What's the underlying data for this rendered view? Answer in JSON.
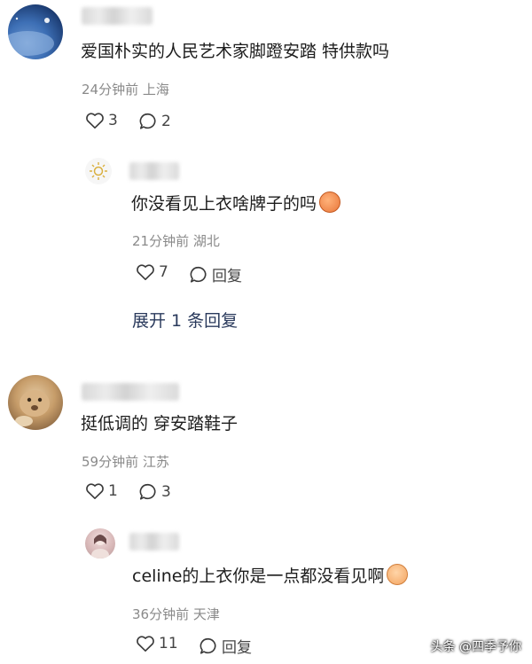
{
  "comments": [
    {
      "text": "爱国朴实的人民艺术家脚蹬安踏 特供款吗",
      "meta": "24分钟前 上海",
      "likes": "3",
      "replies": "2",
      "replies_thread": [
        {
          "text": "你没看见上衣啥牌子的吗",
          "meta": "21分钟前 湖北",
          "likes": "7",
          "reply_label": "回复"
        }
      ],
      "expand_label": "展开 1 条回复"
    },
    {
      "text": "挺低调的 穿安踏鞋子",
      "meta": "59分钟前 江苏",
      "likes": "1",
      "replies": "3",
      "replies_thread": [
        {
          "text": "celine的上衣你是一点都没看见啊",
          "meta": "36分钟前 天津",
          "likes": "11",
          "reply_label": "回复"
        }
      ]
    }
  ],
  "watermark": "头条 @四季予你",
  "icons": {
    "like": "heart-icon",
    "comment": "comment-bubble-icon",
    "emoji": "pumpkin-emoji-icon",
    "emoji2": "crying-face-emoji-icon"
  }
}
